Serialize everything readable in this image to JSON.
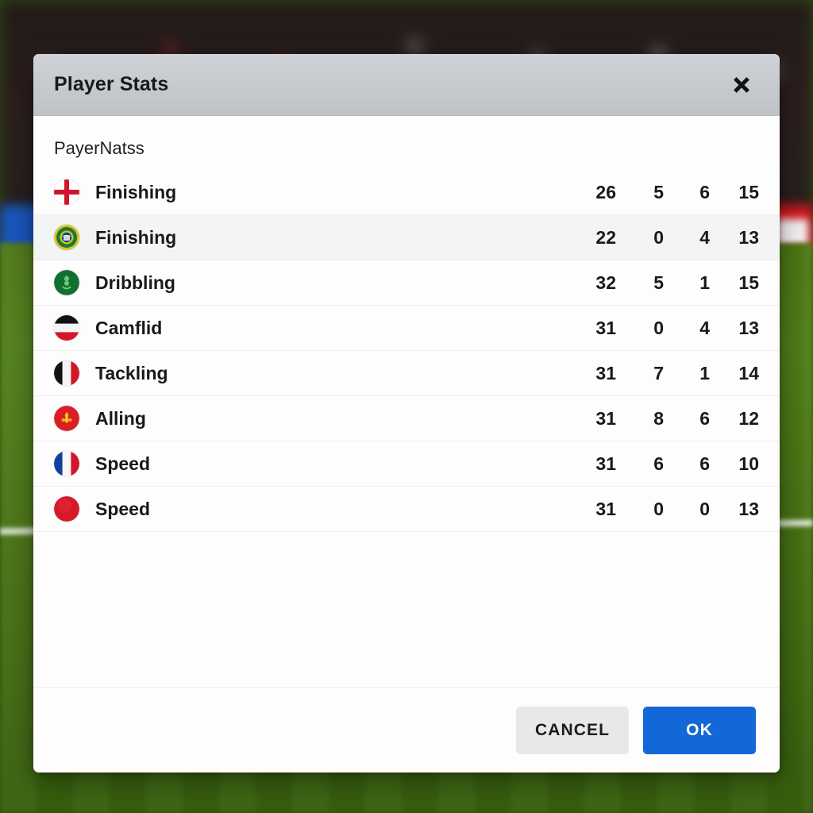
{
  "dialog": {
    "title": "Player Stats",
    "close_icon": "close-icon",
    "section_label": "PayerNatss",
    "rows": [
      {
        "flag": "england-flag-icon",
        "name": "Finishing",
        "v1": "26",
        "v2": "5",
        "v3": "6",
        "v4": "15",
        "highlight": false
      },
      {
        "flag": "brazil-flag-icon",
        "name": "Finishing",
        "v1": "22",
        "v2": "0",
        "v3": "4",
        "v4": "13",
        "highlight": true
      },
      {
        "flag": "green-crest-icon",
        "name": "Dribbling",
        "v1": "32",
        "v2": "5",
        "v3": "1",
        "v4": "15",
        "highlight": false
      },
      {
        "flag": "germany-flag-icon",
        "name": "Camflid",
        "v1": "31",
        "v2": "0",
        "v3": "4",
        "v4": "13",
        "highlight": false
      },
      {
        "flag": "belgium-flag-icon",
        "name": "Tackling",
        "v1": "31",
        "v2": "7",
        "v3": "1",
        "v4": "14",
        "highlight": false
      },
      {
        "flag": "red-crest-icon",
        "name": "Alling",
        "v1": "31",
        "v2": "8",
        "v3": "6",
        "v4": "12",
        "highlight": false
      },
      {
        "flag": "france-flag-icon",
        "name": "Speed",
        "v1": "31",
        "v2": "6",
        "v3": "6",
        "v4": "10",
        "highlight": false
      },
      {
        "flag": "red-circle-flag-icon",
        "name": "Speed",
        "v1": "31",
        "v2": "0",
        "v3": "0",
        "v4": "13",
        "highlight": false
      }
    ],
    "footer": {
      "cancel_label": "CANCEL",
      "ok_label": "OK"
    }
  },
  "colors": {
    "header_bg": "#c6c9ce",
    "dialog_bg": "#fdfdfd",
    "row_highlight": "#f3f4f4",
    "ok_button": "#1268d6",
    "cancel_button": "#e8e8e8",
    "text": "#17191c",
    "pitch_green": "#4a7615",
    "board_blue": "#1a58c0",
    "board_red": "#d61a22"
  }
}
